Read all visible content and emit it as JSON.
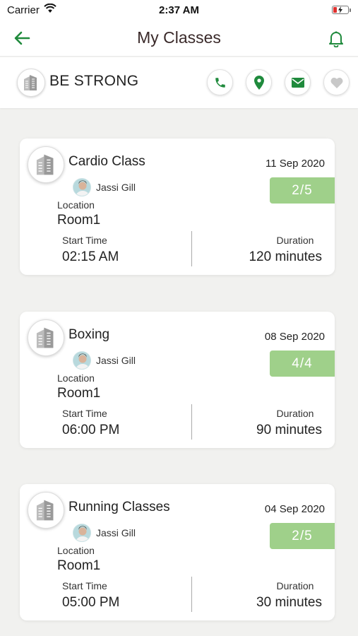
{
  "status_bar": {
    "carrier": "Carrier",
    "time": "2:37 AM"
  },
  "nav": {
    "title": "My Classes",
    "back_icon": "arrow-left-icon",
    "bell_icon": "bell-icon"
  },
  "gym": {
    "name": "BE STRONG",
    "actions": [
      "phone-icon",
      "location-pin-icon",
      "mail-icon",
      "heart-icon"
    ]
  },
  "colors": {
    "accent_green": "#1f8a3c",
    "capacity_green": "#9fd08a",
    "heart_grey": "#c8c8c8"
  },
  "labels": {
    "location": "Location",
    "start_time": "Start Time",
    "duration": "Duration"
  },
  "classes": [
    {
      "name": "Cardio Class",
      "date": "11 Sep 2020",
      "capacity": "2/5",
      "trainer": "Jassi Gill",
      "location": "Room1",
      "start_time": "02:15 AM",
      "duration": "120 minutes"
    },
    {
      "name": "Boxing",
      "date": "08 Sep 2020",
      "capacity": "4/4",
      "trainer": "Jassi Gill",
      "location": "Room1",
      "start_time": "06:00 PM",
      "duration": "90 minutes"
    },
    {
      "name": "Running Classes",
      "date": "04 Sep 2020",
      "capacity": "2/5",
      "trainer": "Jassi Gill",
      "location": "Room1",
      "start_time": "05:00 PM",
      "duration": "30 minutes"
    }
  ]
}
